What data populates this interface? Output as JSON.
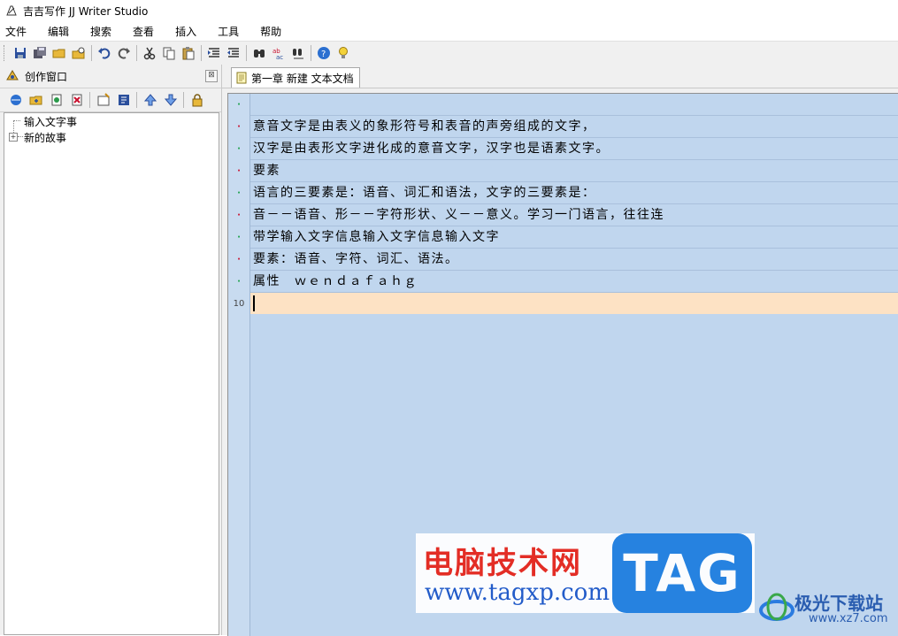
{
  "window": {
    "title": "吉吉写作 JJ Writer Studio"
  },
  "menu": [
    "文件",
    "编辑",
    "搜索",
    "查看",
    "插入",
    "工具",
    "帮助"
  ],
  "toolbar_icons": [
    "save-icon",
    "save-all-icon",
    "open-icon",
    "close-file-icon",
    "undo-icon",
    "redo-icon",
    "cut-icon",
    "copy-icon",
    "paste-icon",
    "indent-icon",
    "outdent-icon",
    "find-icon",
    "replace-icon",
    "find-next-icon",
    "help-icon",
    "tip-icon"
  ],
  "left_panel": {
    "title": "创作窗口",
    "close_label": "⊠",
    "toolbar_icons": [
      "new-book-icon",
      "new-folder-icon",
      "new-chapter-icon",
      "delete-icon",
      "properties-icon",
      "notes-icon",
      "move-up-icon",
      "move-down-icon",
      "lock-icon"
    ],
    "tree": [
      {
        "label": "输入文字事",
        "expandable": false
      },
      {
        "label": "新的故事",
        "expandable": true,
        "expander": "+"
      }
    ]
  },
  "editor": {
    "tab_label": "第一章 新建 文本文档",
    "lines": [
      {
        "marker": "·",
        "text": ""
      },
      {
        "marker": "·",
        "text": "意音文字是由表义的象形符号和表音的声旁组成的文字，"
      },
      {
        "marker": "·",
        "text": "汉字是由表形文字进化成的意音文字，汉字也是语素文字。"
      },
      {
        "marker": "·",
        "text": "要素"
      },
      {
        "marker": "·",
        "text": "语言的三要素是：语音、词汇和语法，文字的三要素是："
      },
      {
        "marker": "·",
        "text": "音－－语音、形－－字符形状、义－－意义。学习一门语言，往往连"
      },
      {
        "marker": "·",
        "text": "带学输入文字信息输入文字信息输入文字"
      },
      {
        "marker": "·",
        "text": "要素：语音、字符、词汇、语法。"
      },
      {
        "marker": "·",
        "text": "属性　ｗｅｎｄａｆａｈｇ"
      },
      {
        "marker": "10",
        "text": "",
        "current": true
      }
    ],
    "marker_colors": [
      "#1aa048",
      "#c8102e",
      "#1aa048",
      "#c8102e",
      "#1aa048",
      "#c8102e",
      "#1aa048",
      "#c8102e",
      "#1aa048"
    ]
  },
  "watermark": {
    "cn": "电脑技术网",
    "url": "www.tagxp.com",
    "tag": "TAG",
    "site_name": "极光下载站",
    "site_url": "www.xz7.com"
  }
}
